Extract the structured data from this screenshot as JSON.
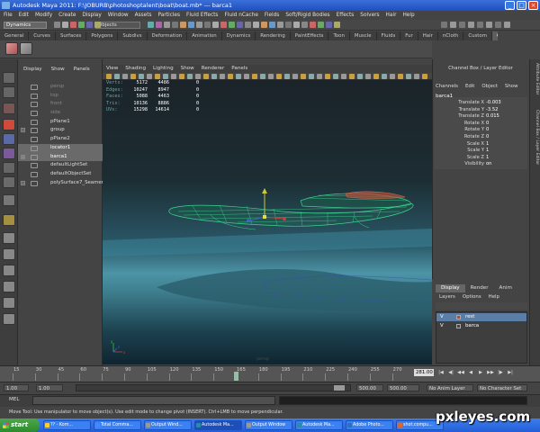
{
  "window": {
    "title": "Autodesk Maya 2011: F:\\JOBURB\\photoshoptalent\\boat\\boat.mb*   ---   barca1",
    "controls": [
      "_",
      "□",
      "×"
    ]
  },
  "menu": [
    "File",
    "Edit",
    "Modify",
    "Create",
    "Display",
    "Window",
    "Assets",
    "Particles",
    "Fluid Effects",
    "Fluid nCache",
    "Fields",
    "Soft/Rigid Bodies",
    "Effects",
    "Solvers",
    "Hair",
    "Help"
  ],
  "status_line": {
    "mode": "Dynamics",
    "selection_field": "Objects"
  },
  "shelf_tabs": [
    "General",
    "Curves",
    "Surfaces",
    "Polygons",
    "Subdivs",
    "Deformation",
    "Animation",
    "Dynamics",
    "Rendering",
    "PaintEffects",
    "Toon",
    "Muscle",
    "Fluids",
    "Fur",
    "Hair",
    "nCloth",
    "Custom",
    "GoZBrush"
  ],
  "shelf_active": "GoZBrush",
  "outliner": {
    "menu": [
      "Display",
      "Show",
      "Panels"
    ],
    "items": [
      {
        "label": "persp",
        "dim": true,
        "expand": ""
      },
      {
        "label": "top",
        "dim": true,
        "expand": ""
      },
      {
        "label": "front",
        "dim": true,
        "expand": ""
      },
      {
        "label": "side",
        "dim": true,
        "expand": ""
      },
      {
        "label": "pPlane1",
        "dim": false,
        "expand": ""
      },
      {
        "label": "group",
        "dim": false,
        "expand": "+"
      },
      {
        "label": "pPlane2",
        "dim": false,
        "expand": ""
      },
      {
        "label": "locator1",
        "dim": false,
        "expand": "",
        "selected": true
      },
      {
        "label": "barca1",
        "dim": false,
        "expand": "+",
        "selected": true
      },
      {
        "label": "defaultLightSet",
        "dim": false,
        "expand": ""
      },
      {
        "label": "defaultObjectSet",
        "dim": false,
        "expand": ""
      },
      {
        "label": "polySurface7_Seamer",
        "dim": false,
        "expand": "+"
      }
    ]
  },
  "viewport": {
    "menu": [
      "View",
      "Shading",
      "Lighting",
      "Show",
      "Renderer",
      "Panels"
    ],
    "hud": [
      {
        "label": "Verts:",
        "v1": "5172",
        "v2": "4486",
        "v3": "0"
      },
      {
        "label": "Edges:",
        "v1": "10247",
        "v2": "8947",
        "v3": "0"
      },
      {
        "label": "Faces:",
        "v1": "5088",
        "v2": "4463",
        "v3": "0"
      },
      {
        "label": "Tris:",
        "v1": "10136",
        "v2": "8886",
        "v3": "0"
      },
      {
        "label": "UVs:",
        "v1": "15298",
        "v2": "14614",
        "v3": "0"
      }
    ],
    "camera": "persp",
    "axis": {
      "x": "x",
      "y": "y",
      "z": "z"
    }
  },
  "channel_box": {
    "title": "Channel Box / Layer Editor",
    "menu": [
      "Channels",
      "Edit",
      "Object",
      "Show"
    ],
    "object": "barca1",
    "attributes": [
      {
        "name": "Translate X",
        "value": "-0.003"
      },
      {
        "name": "Translate Y",
        "value": "-3.52"
      },
      {
        "name": "Translate Z",
        "value": "0.015"
      },
      {
        "name": "Rotate X",
        "value": "0"
      },
      {
        "name": "Rotate Y",
        "value": "0"
      },
      {
        "name": "Rotate Z",
        "value": "0"
      },
      {
        "name": "Scale X",
        "value": "1"
      },
      {
        "name": "Scale Y",
        "value": "1"
      },
      {
        "name": "Scale Z",
        "value": "1"
      },
      {
        "name": "Visibility",
        "value": "on"
      }
    ]
  },
  "side_tabs": [
    "Attribute Editor",
    "Channel Box / Layer Editor"
  ],
  "layer_editor": {
    "tabs": [
      "Display",
      "Render",
      "Anim"
    ],
    "active_tab": "Display",
    "menu": [
      "Layers",
      "Options",
      "Help"
    ],
    "layers": [
      {
        "visible": "V",
        "name": "rest",
        "color": "#b04a3a",
        "selected": true
      },
      {
        "visible": "V",
        "name": "barca",
        "color": "#444444",
        "selected": false
      }
    ]
  },
  "time_slider": {
    "ticks": [
      "15",
      "30",
      "45",
      "60",
      "75",
      "90",
      "105",
      "120",
      "135",
      "150",
      "165",
      "180",
      "195",
      "210",
      "225",
      "240",
      "255",
      "270"
    ],
    "current_frame": "281.00",
    "playback": [
      "|◀",
      "◀|",
      "◀◀",
      "◀",
      "▶",
      "▶▶",
      "|▶",
      "▶|"
    ]
  },
  "range_slider": {
    "start": "1.00",
    "playback_start": "1.00",
    "playback_end": "500.00",
    "end": "500.00",
    "anim_layer": "No Anim Layer",
    "character_set": "No Character Set"
  },
  "command_line": {
    "label": "MEL"
  },
  "help_line": "Move Tool: Use manipulator to move object(s). Use edit mode to change pivot (INSERT). Ctrl+LMB to move perpendicular.",
  "taskbar": {
    "start": "start",
    "tasks": [
      {
        "label": "?? - Kom...",
        "color": "#ffcc33"
      },
      {
        "label": "Total Comma...",
        "color": "#4488ff"
      },
      {
        "label": "Output Wind...",
        "color": "#999999"
      },
      {
        "label": "Autodesk Ma...",
        "color": "#2a8aaa",
        "active": true
      },
      {
        "label": "Output Window",
        "color": "#999999"
      },
      {
        "label": "Autodesk Ma...",
        "color": "#2a8aaa"
      },
      {
        "label": "Adobe Photo...",
        "color": "#2a6fc0"
      },
      {
        "label": "shot.compu...",
        "color": "#dd6633"
      }
    ]
  },
  "watermark": "pxleyes.com"
}
